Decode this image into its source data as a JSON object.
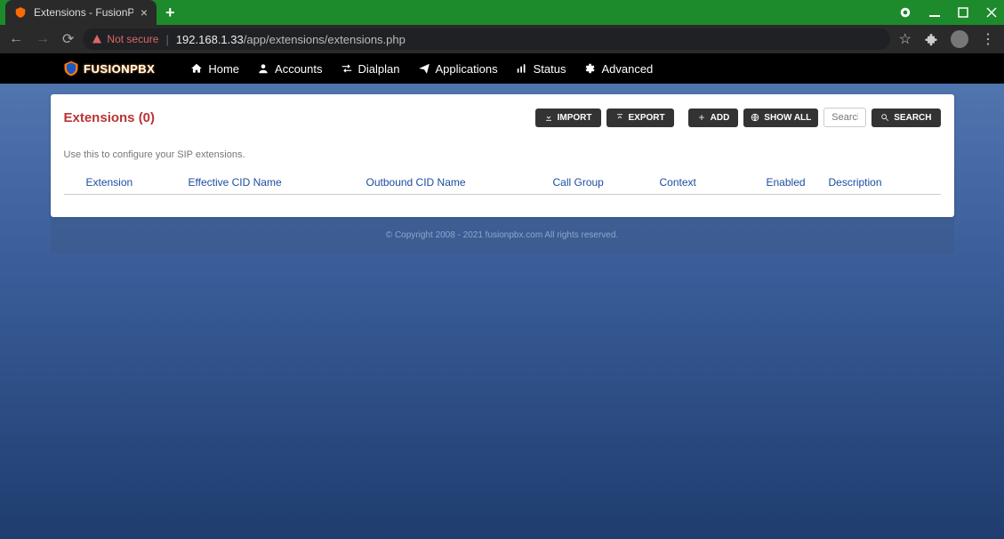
{
  "browser": {
    "tab_title": "Extensions - FusionPBX",
    "url_host": "192.168.1.33",
    "url_path": "/app/extensions/extensions.php",
    "not_secure_label": "Not secure"
  },
  "nav": {
    "logo_text": "FUSIONPBX",
    "items": [
      {
        "icon": "home",
        "label": "Home"
      },
      {
        "icon": "user",
        "label": "Accounts"
      },
      {
        "icon": "exchange",
        "label": "Dialplan"
      },
      {
        "icon": "plane",
        "label": "Applications"
      },
      {
        "icon": "bars",
        "label": "Status"
      },
      {
        "icon": "gear",
        "label": "Advanced"
      }
    ]
  },
  "page": {
    "title": "Extensions (0)",
    "description": "Use this to configure your SIP extensions.",
    "buttons": {
      "import": "IMPORT",
      "export": "EXPORT",
      "add": "ADD",
      "showall": "SHOW ALL",
      "search": "SEARCH"
    },
    "search_placeholder": "Search...",
    "columns": {
      "extension": "Extension",
      "effective_cid": "Effective CID Name",
      "outbound_cid": "Outbound CID Name",
      "call_group": "Call Group",
      "context": "Context",
      "enabled": "Enabled",
      "description": "Description"
    }
  },
  "footer": "© Copyright 2008 - 2021 fusionpbx.com All rights reserved."
}
